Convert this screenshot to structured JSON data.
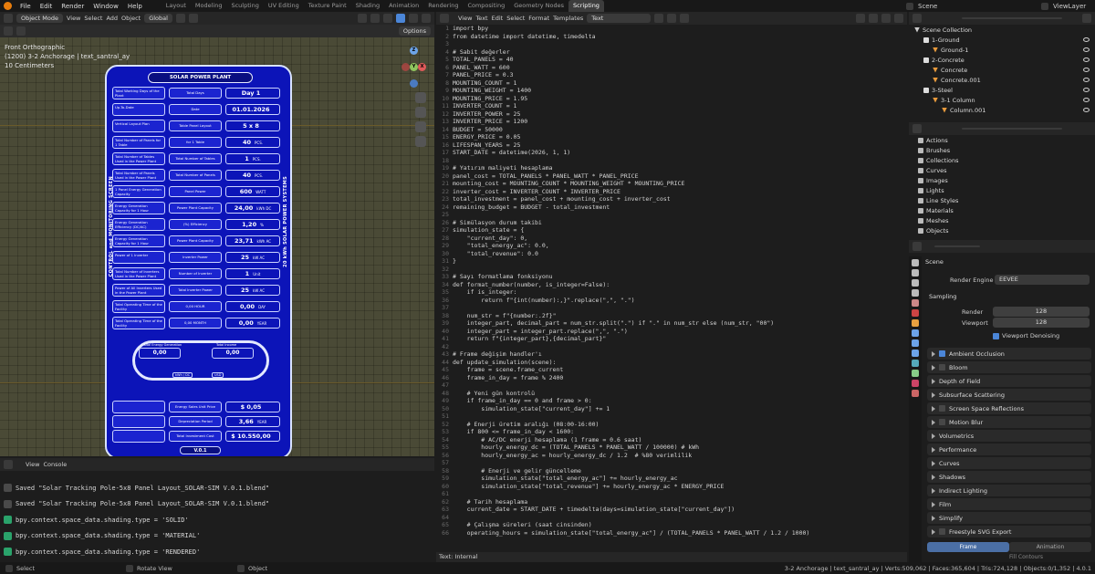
{
  "menu": [
    "File",
    "Edit",
    "Render",
    "Window",
    "Help"
  ],
  "workspaces": [
    "Layout",
    "Modeling",
    "Sculpting",
    "UV Editing",
    "Texture Paint",
    "Shading",
    "Animation",
    "Rendering",
    "Compositing",
    "Geometry Nodes",
    "Scripting"
  ],
  "active_workspace": "Scripting",
  "scene": "Scene",
  "view_layer": "ViewLayer",
  "viewport": {
    "mode": "Object Mode",
    "menus": [
      "View",
      "Select",
      "Add",
      "Object"
    ],
    "transform": "Global",
    "options": "Options",
    "info": [
      "Front Orthographic",
      "(1200) 3-2 Anchorage | text_santral_ay",
      "10 Centimeters"
    ],
    "gizmo": {
      "x": "X",
      "y": "Y",
      "z": "Z"
    }
  },
  "poster": {
    "title": "SOLAR POWER PLANT",
    "left_side": "CONTROL and MONITORING SCREEN",
    "right_side": "20 kWh SOLAR POWER SYSTEMS",
    "version": "V.0.1",
    "rows": [
      {
        "label": "Total Working Days of the Plant",
        "name": "Total Days",
        "value": "Day 1",
        "unit": ""
      },
      {
        "label": "Up-To-Date",
        "name": "Date",
        "value": "01.01.2026",
        "unit": ""
      },
      {
        "label": "Vertical Layout Plan",
        "name": "Table Panel Layout",
        "value": "5 x 8",
        "unit": ""
      },
      {
        "label": "Total Number of Panels for 1 Table",
        "name": "for 1 Table",
        "value": "40",
        "unit": "PCS."
      },
      {
        "label": "Total Number of Tables Used in the Power Plant",
        "name": "Total Number of Tables",
        "value": "1",
        "unit": "PCS."
      },
      {
        "label": "Total Number of Panels Used in the Power Plant",
        "name": "Total Number of Panels",
        "value": "40",
        "unit": "PCS."
      },
      {
        "label": "1 Panel Energy Generation Capacity",
        "name": "Panel Power",
        "value": "600",
        "unit": "WATT"
      },
      {
        "label": "Energy Generation Capacity for 1 Hour",
        "name": "Power Plant Capacity",
        "value": "24,00",
        "unit": "kWh   DC"
      },
      {
        "label": "Energy Generation Efficiency (DC/AC)",
        "name": "(%) Efficiency",
        "value": "1,20",
        "unit": "%"
      },
      {
        "label": "Energy Generation Capacity for 1 Hour",
        "name": "Power Plant Capacity",
        "value": "23,71",
        "unit": "kWh   AC"
      },
      {
        "label": "Power of 1 Inverter",
        "name": "Inverter Power",
        "value": "25",
        "unit": "kW   AC"
      },
      {
        "label": "Total Number of Inverters Used in the Power Plant",
        "name": "Number of Inverter",
        "value": "1",
        "unit": "Unit"
      },
      {
        "label": "Power of All Inverters Used in the Power Plant",
        "name": "Total Inverter Power",
        "value": "25",
        "unit": "kW   AC"
      },
      {
        "label": "Total Operating Time of the Facility",
        "name": "0,00   HOUR",
        "value": "0,00",
        "unit": "DAY"
      },
      {
        "label": "Total Operating Time of the Facility",
        "name": "0,00   MONTH",
        "value": "0,00",
        "unit": "YEAR"
      }
    ],
    "oval": {
      "gen_label": "Total Energy Generation",
      "income_label": "Total Income",
      "gen_value": "0,00",
      "income_value": "0,00",
      "gen_unit": "kWh / DC",
      "income_unit": "USD"
    },
    "bottom_rows": [
      {
        "label": "",
        "name": "Energy Sales Unit Price",
        "value": "$  0,05",
        "unit": ""
      },
      {
        "label": "",
        "name": "Depreciation Period",
        "value": "3,66",
        "unit": "YEAR"
      },
      {
        "label": "",
        "name": "Total Investment Cost",
        "value": "$ 10.550,00",
        "unit": ""
      }
    ]
  },
  "console": {
    "tabs": [
      "View",
      "Console"
    ],
    "lines": [
      "Saved \"Solar Tracking Pole-5x8 Panel Layout_SOLAR-SIM V.0.1.blend\"",
      "Saved \"Solar Tracking Pole-5x8 Panel Layout_SOLAR-SIM V.0.1.blend\"",
      "bpy.context.space_data.shading.type = 'SOLID'",
      "bpy.context.space_data.shading.type = 'MATERIAL'",
      "bpy.context.space_data.shading.type = 'RENDERED'"
    ]
  },
  "editor": {
    "menus": [
      "View",
      "Text",
      "Edit",
      "Select",
      "Format",
      "Templates"
    ],
    "text_name": "Text",
    "footer": "Text: Internal"
  },
  "code": [
    "import bpy",
    "from datetime import datetime, timedelta",
    "",
    "# Sabit değerler",
    "TOTAL_PANELS = 40",
    "PANEL_WATT = 600",
    "PANEL_PRICE = 0.3",
    "MOUNTING_COUNT = 1",
    "MOUNTING_WEIGHT = 1400",
    "MOUNTING_PRICE = 1.95",
    "INVERTER_COUNT = 1",
    "INVERTER_POWER = 25",
    "INVERTER_PRICE = 1200",
    "BUDGET = 50000",
    "ENERGY_PRICE = 0.05",
    "LIFESPAN_YEARS = 25",
    "START_DATE = datetime(2026, 1, 1)",
    "",
    "# Yatırım maliyeti hesaplama",
    "panel_cost = TOTAL_PANELS * PANEL_WATT * PANEL_PRICE",
    "mounting_cost = MOUNTING_COUNT * MOUNTING_WEIGHT * MOUNTING_PRICE",
    "inverter_cost = INVERTER_COUNT * INVERTER_PRICE",
    "total_investment = panel_cost + mounting_cost + inverter_cost",
    "remaining_budget = BUDGET - total_investment",
    "",
    "# Simülasyon durum takibi",
    "simulation_state = {",
    "    \"current_day\": 0,",
    "    \"total_energy_ac\": 0.0,",
    "    \"total_revenue\": 0.0",
    "}",
    "",
    "# Sayı formatlama fonksiyonu",
    "def format_number(number, is_integer=False):",
    "    if is_integer:",
    "        return f\"{int(number):,}\".replace(\",\", \".\")",
    "",
    "    num_str = f\"{number:.2f}\"",
    "    integer_part, decimal_part = num_str.split(\".\") if \".\" in num_str else (num_str, \"00\")",
    "    integer_part = integer_part.replace(\",\", \".\")",
    "    return f\"{integer_part},{decimal_part}\"",
    "",
    "# Frame değişim handler'ı",
    "def update_simulation(scene):",
    "    frame = scene.frame_current",
    "    frame_in_day = frame % 2400",
    "",
    "    # Yeni gün kontrolü",
    "    if frame_in_day == 0 and frame > 0:",
    "        simulation_state[\"current_day\"] += 1",
    "",
    "    # Enerji üretim aralığı (08:00-16:00)",
    "    if 800 <= frame_in_day < 1600:",
    "        # AC/DC enerji hesaplama (1 frame = 0.6 saat)",
    "        hourly_energy_dc = (TOTAL_PANELS * PANEL_WATT / 100000) # kWh",
    "        hourly_energy_ac = hourly_energy_dc / 1.2  # %80 verimlilik",
    "",
    "        # Enerji ve gelir güncelleme",
    "        simulation_state[\"total_energy_ac\"] += hourly_energy_ac",
    "        simulation_state[\"total_revenue\"] += hourly_energy_ac * ENERGY_PRICE",
    "",
    "    # Tarih hesaplama",
    "    current_date = START_DATE + timedelta(days=simulation_state[\"current_day\"])",
    "",
    "    # Çalışma süreleri (saat cinsinden)",
    "    operating_hours = simulation_state[\"total_energy_ac\"] / (TOTAL_PANELS * PANEL_WATT / 1.2 / 1000)"
  ],
  "outliner": {
    "items": [
      {
        "label": "Scene Collection",
        "depth": 0
      },
      {
        "label": "1-Ground",
        "depth": 1
      },
      {
        "label": "Ground-1",
        "depth": 2
      },
      {
        "label": "2-Concrete",
        "depth": 1
      },
      {
        "label": "Concrete",
        "depth": 2
      },
      {
        "label": "Concrete.001",
        "depth": 2
      },
      {
        "label": "3-Steel",
        "depth": 1
      },
      {
        "label": "3-1 Column",
        "depth": 2
      },
      {
        "label": "Column.001",
        "depth": 3
      }
    ]
  },
  "data": {
    "items": [
      "Actions",
      "Brushes",
      "Collections",
      "Curves",
      "Images",
      "Lights",
      "Line Styles",
      "Materials",
      "Meshes",
      "Objects"
    ]
  },
  "props": {
    "scene": "Scene",
    "render_engine_label": "Render Engine",
    "render_engine": "EEVEE",
    "sampling": "Sampling",
    "render_label": "Render",
    "render_value": "128",
    "viewport_label": "Viewport",
    "viewport_value": "128",
    "denoise": "Viewport Denoising",
    "sections": [
      {
        "label": "Ambient Occlusion",
        "check": true
      },
      {
        "label": "Bloom",
        "check": false
      },
      {
        "label": "Depth of Field",
        "check": null
      },
      {
        "label": "Subsurface Scattering",
        "check": null
      },
      {
        "label": "Screen Space Reflections",
        "check": false
      },
      {
        "label": "Motion Blur",
        "check": false
      },
      {
        "label": "Volumetrics",
        "check": null
      },
      {
        "label": "Performance",
        "check": null
      },
      {
        "label": "Curves",
        "check": null
      },
      {
        "label": "Shadows",
        "check": null
      },
      {
        "label": "Indirect Lighting",
        "check": null
      },
      {
        "label": "Film",
        "check": null
      },
      {
        "label": "Simplify",
        "check": null
      },
      {
        "label": "Freestyle SVG Export",
        "check": false
      }
    ],
    "frame_tab": "Frame",
    "animation_tab": "Animation",
    "fill_contours": "Fill Contours"
  },
  "status": {
    "select": "Select",
    "rotate": "Rotate View",
    "object": "Object",
    "stats": "3-2 Anchorage | text_santral_ay | Verts:509,062 | Faces:365,604 | Tris:724,128 | Objects:0/1,352 | 4.0.1"
  }
}
